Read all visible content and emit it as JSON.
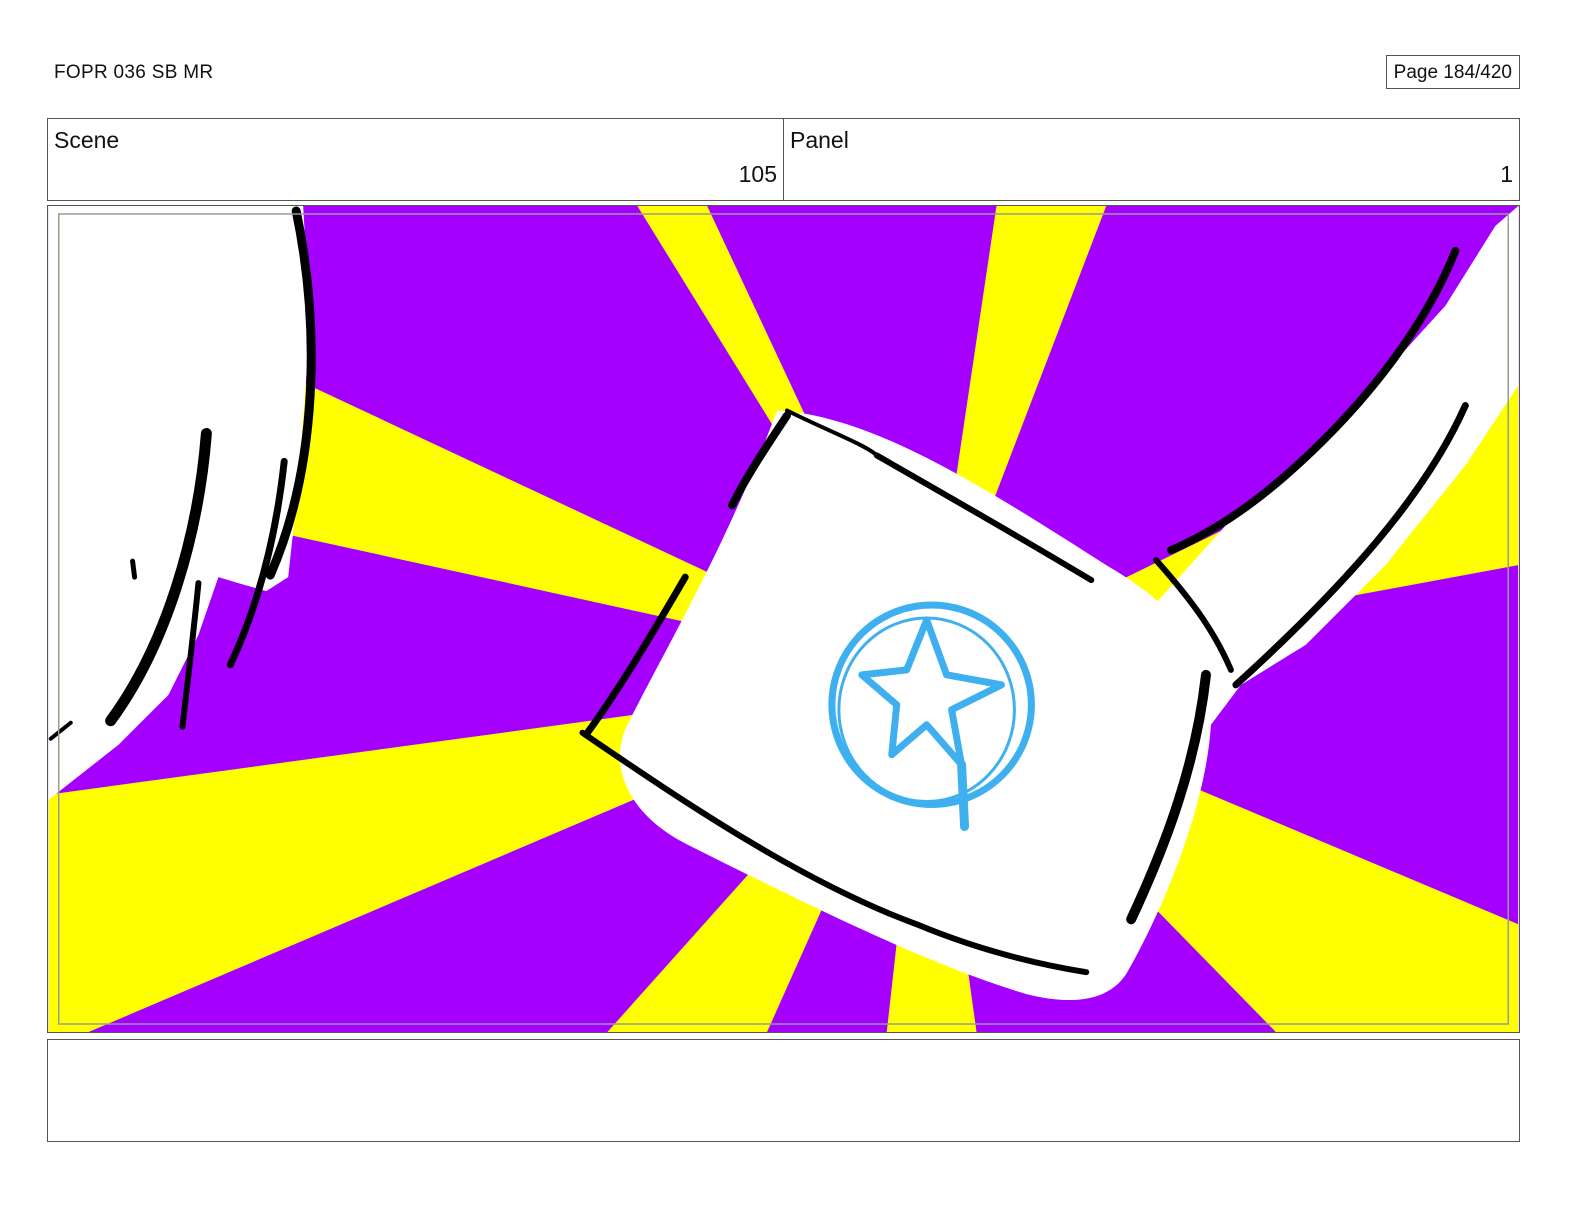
{
  "header": {
    "title": "FOPR 036 SB MR",
    "page": "Page 184/420"
  },
  "info": {
    "scene_label": "Scene",
    "scene_value": "105",
    "panel_label": "Panel",
    "panel_value": "1"
  },
  "panel_art": {
    "colors": {
      "purple": "#a500ff",
      "yellow": "#ffff00",
      "white": "#ffffff",
      "ink": "#000000",
      "emblem": "#3fb0ef"
    },
    "icons": [
      "star-emblem-icon"
    ]
  },
  "notes": {
    "text": ""
  }
}
